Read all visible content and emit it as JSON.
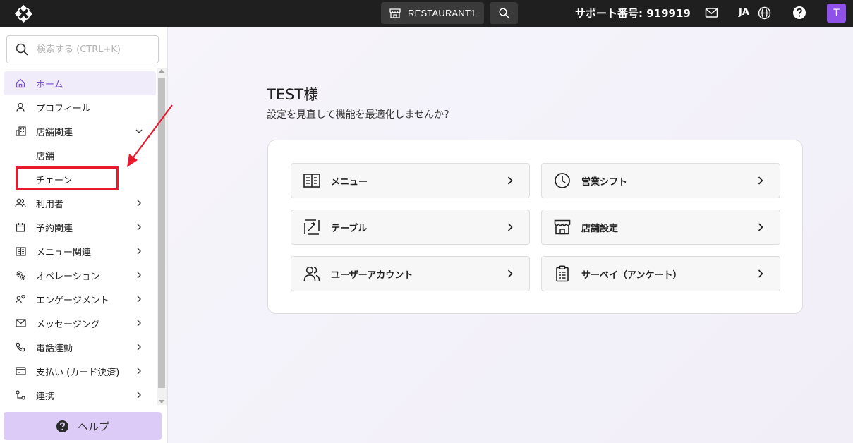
{
  "topbar": {
    "store_name": "RESTAURANT1",
    "support_label": "サポート番号: 919919",
    "language": "JA",
    "avatar_letter": "T"
  },
  "sidebar": {
    "search_placeholder": "検索する (CTRL+K)",
    "items": [
      {
        "label": "ホーム",
        "icon": "home-icon",
        "active": true
      },
      {
        "label": "プロフィール",
        "icon": "user-icon"
      },
      {
        "label": "店舗関連",
        "icon": "building-icon",
        "expanded": true
      },
      {
        "label": "店舗",
        "sub": true
      },
      {
        "label": "チェーン",
        "sub": true,
        "highlighted": true
      },
      {
        "label": "利用者",
        "icon": "users-icon"
      },
      {
        "label": "予約関連",
        "icon": "calendar-icon"
      },
      {
        "label": "メニュー関連",
        "icon": "menu-book-icon"
      },
      {
        "label": "オペレーション",
        "icon": "gears-icon"
      },
      {
        "label": "エンゲージメント",
        "icon": "engagement-icon"
      },
      {
        "label": "メッセージング",
        "icon": "mail-icon"
      },
      {
        "label": "電話連動",
        "icon": "phone-icon"
      },
      {
        "label": "支払い (カード決済)",
        "icon": "card-icon"
      },
      {
        "label": "連携",
        "icon": "integration-icon"
      }
    ],
    "help_label": "ヘルプ"
  },
  "main": {
    "greeting": "TEST様",
    "subtitle": "設定を見直して機能を最適化しませんか？",
    "tiles": [
      {
        "label": "メニュー",
        "icon": "menu-book-icon"
      },
      {
        "label": "営業シフト",
        "icon": "clock-icon"
      },
      {
        "label": "テーブル",
        "icon": "table-icon"
      },
      {
        "label": "店舗設定",
        "icon": "store-icon"
      },
      {
        "label": "ユーザーアカウント",
        "icon": "users-icon"
      },
      {
        "label": "サーベイ（アンケート）",
        "icon": "clipboard-icon"
      }
    ]
  },
  "colors": {
    "accent": "#8e52e8",
    "active_bg": "#f0ecfa",
    "help_bg": "#dccbf7",
    "annotation": "#e8192c"
  }
}
